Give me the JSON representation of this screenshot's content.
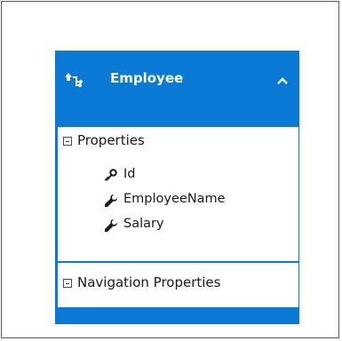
{
  "entity": {
    "title": "Employee",
    "entity_icon": "entity-type-icon",
    "collapse_icon": "chevron-up-icon",
    "header_color": "#0a7ad4"
  },
  "properties_section": {
    "label": "Properties",
    "expander_icon": "collapse-box-icon",
    "items": [
      {
        "label": "Id",
        "icon": "key-icon"
      },
      {
        "label": "EmployeeName",
        "icon": "wrench-icon"
      },
      {
        "label": "Salary",
        "icon": "wrench-icon"
      }
    ]
  },
  "navigation_section": {
    "label": "Navigation Properties",
    "expander_icon": "collapse-box-icon"
  }
}
